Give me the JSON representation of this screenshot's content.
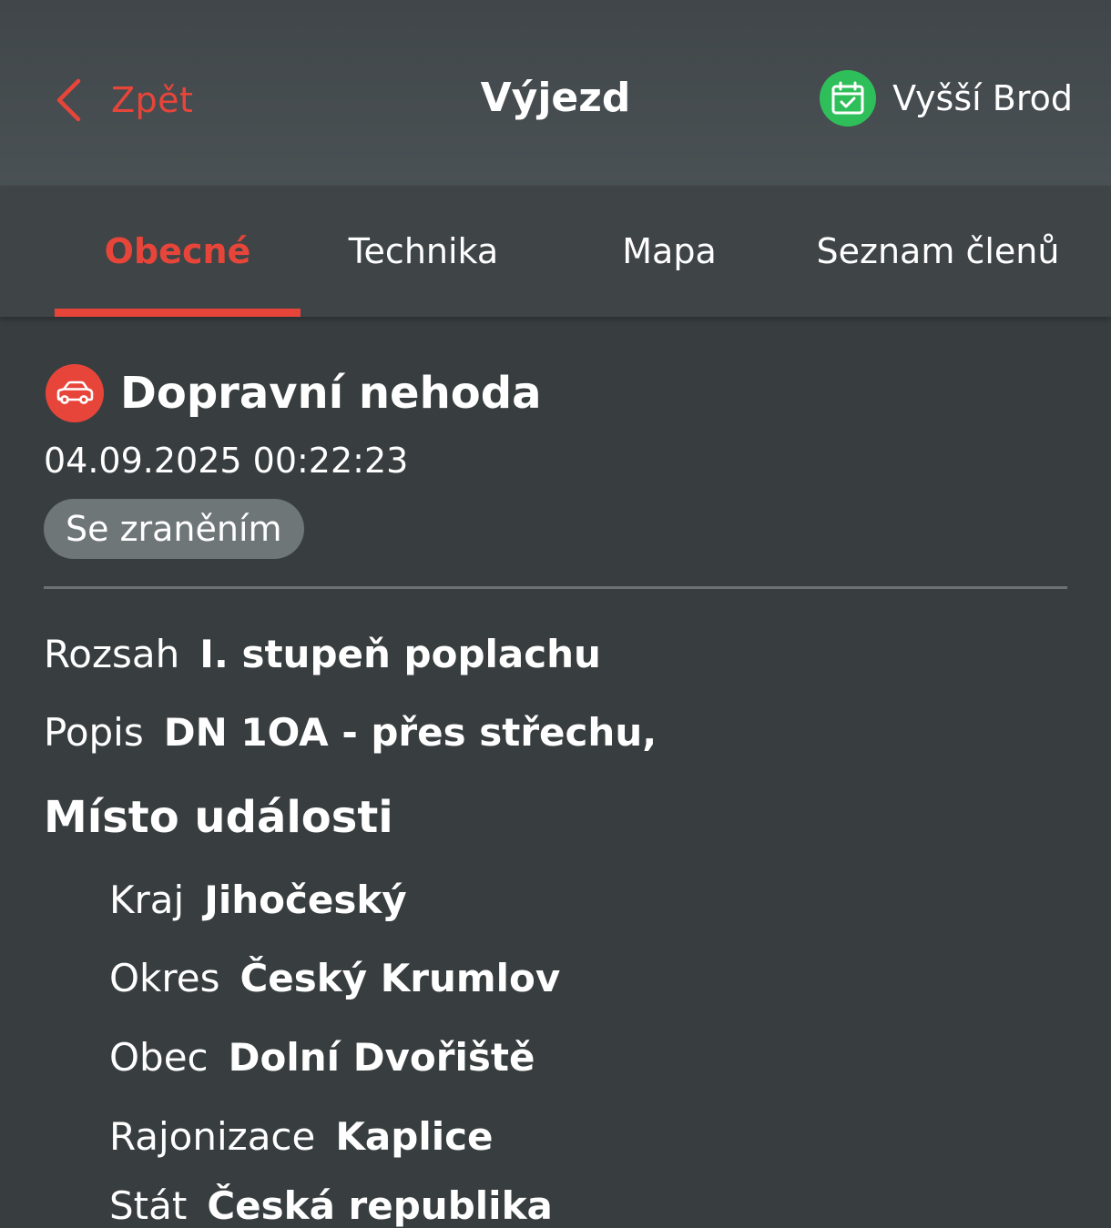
{
  "header": {
    "back_label": "Zpět",
    "title": "Výjezd",
    "station_name": "Vyšší Brod",
    "station_icon": "calendar-check-icon",
    "back_icon": "chevron-left-icon"
  },
  "tabs": [
    {
      "label": "Obecné",
      "active": true
    },
    {
      "label": "Technika",
      "active": false
    },
    {
      "label": "Mapa",
      "active": false
    },
    {
      "label": "Seznam členů",
      "active": false
    }
  ],
  "incident": {
    "icon": "car-icon",
    "title": "Dopravní nehoda",
    "datetime": "04.09.2025 00:22:23",
    "badge": "Se zraněním"
  },
  "details": {
    "rozsah": {
      "key": "Rozsah",
      "value": "I. stupeň poplachu"
    },
    "popis": {
      "key": "Popis",
      "value": "DN 1OA - přes střechu,"
    }
  },
  "location": {
    "title": "Místo události",
    "kraj": {
      "key": "Kraj",
      "value": "Jihočeský"
    },
    "okres": {
      "key": "Okres",
      "value": "Český Krumlov"
    },
    "obec": {
      "key": "Obec",
      "value": "Dolní Dvořiště"
    },
    "rajonizace": {
      "key": "Rajonizace",
      "value": "Kaplice"
    },
    "stat": {
      "key": "Stát",
      "value": "Česká republika"
    }
  },
  "colors": {
    "accent": "#e8453a",
    "station_green": "#2fbf5a",
    "background": "#383e3f",
    "header": "#474d50",
    "badge": "#6f7677"
  }
}
